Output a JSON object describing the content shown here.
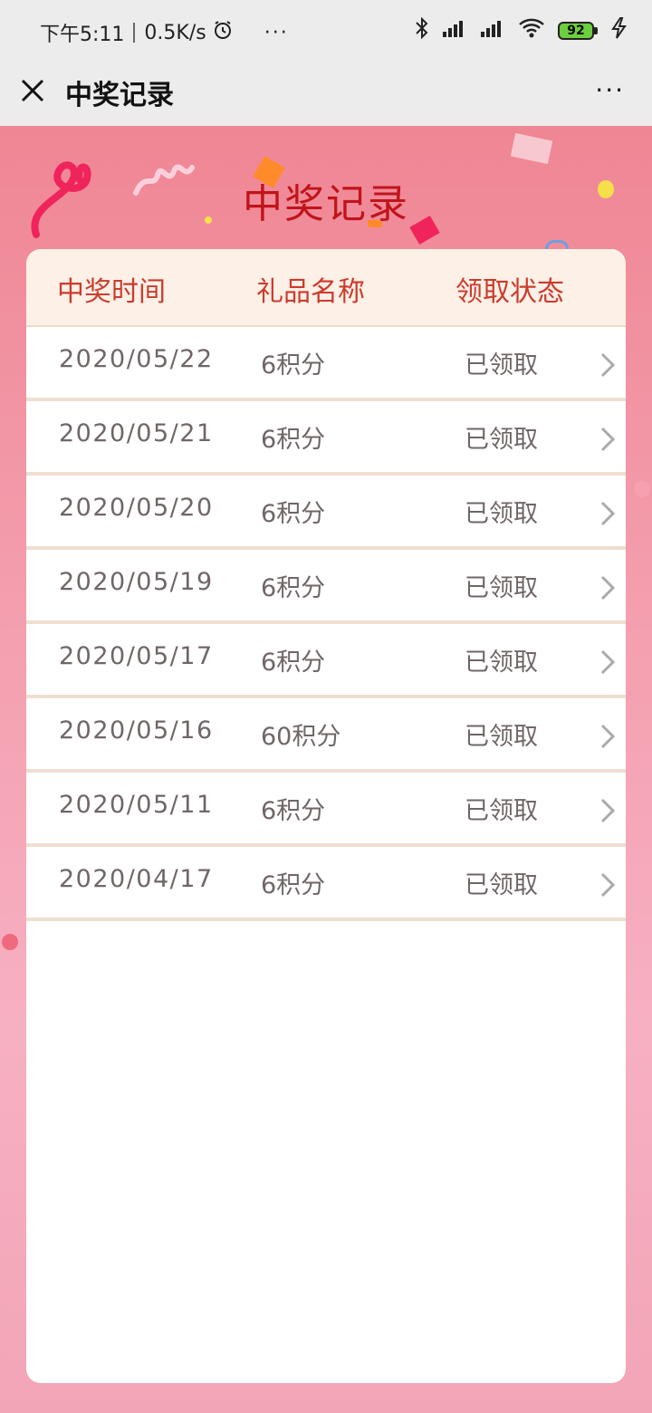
{
  "status_bar": {
    "time": "下午5:11",
    "speed": "0.5K/s",
    "alarm_icon": "alarm-icon",
    "more": "···",
    "battery": "92",
    "icons": [
      "bluetooth-icon",
      "signal-icon",
      "signal-icon",
      "wifi-icon",
      "battery-icon",
      "charging-icon"
    ]
  },
  "nav": {
    "close_icon": "close-icon",
    "title": "中奖记录",
    "more_icon": "more-icon",
    "more": "···"
  },
  "page": {
    "title": "中奖记录",
    "colors": {
      "accent": "#c0141a",
      "header_text": "#cc3b2e",
      "background": "#ef8694"
    }
  },
  "table": {
    "headers": [
      "中奖时间",
      "礼品名称",
      "领取状态"
    ],
    "rows": [
      {
        "date": "2020/05/22",
        "gift": "6积分",
        "status": "已领取"
      },
      {
        "date": "2020/05/21",
        "gift": "6积分",
        "status": "已领取"
      },
      {
        "date": "2020/05/20",
        "gift": "6积分",
        "status": "已领取"
      },
      {
        "date": "2020/05/19",
        "gift": "6积分",
        "status": "已领取"
      },
      {
        "date": "2020/05/17",
        "gift": "6积分",
        "status": "已领取"
      },
      {
        "date": "2020/05/16",
        "gift": "60积分",
        "status": "已领取"
      },
      {
        "date": "2020/05/11",
        "gift": "6积分",
        "status": "已领取"
      },
      {
        "date": "2020/04/17",
        "gift": "6积分",
        "status": "已领取"
      }
    ],
    "row_icon": "chevron-right-icon"
  }
}
